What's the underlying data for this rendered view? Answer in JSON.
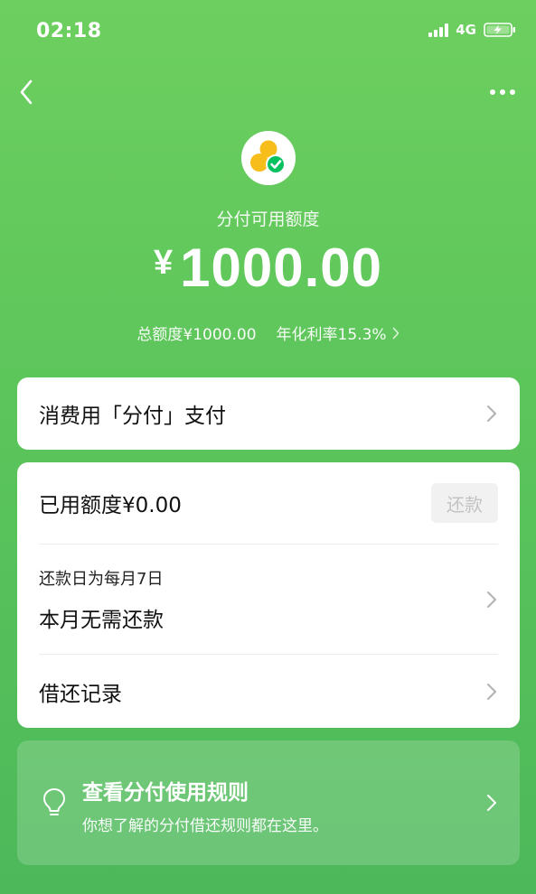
{
  "status_bar": {
    "time": "02:18",
    "network": "4G"
  },
  "header": {
    "credit_label": "分付可用额度",
    "currency_symbol": "¥",
    "available_amount": "1000.00",
    "total_credit": "总额度¥1000.00",
    "annual_rate": "年化利率15.3%"
  },
  "pay_card": {
    "title": "消费用「分付」支付"
  },
  "main_card": {
    "used_credit": "已用额度¥0.00",
    "repay_button": "还款",
    "repay_day": "还款日为每月7日",
    "repay_status": "本月无需还款",
    "records": "借还记录"
  },
  "rules_card": {
    "title": "查看分付使用规则",
    "subtitle": "你想了解的分付借还规则都在这里。"
  },
  "colors": {
    "brand_green": "#5cc55b",
    "check_green": "#07c160",
    "coin_yellow": "#f7bd1a"
  },
  "icons": {
    "back": "chevron-left-icon",
    "more": "more-dots-icon",
    "logo": "fenfu-coins-logo",
    "chevron": "chevron-right-icon",
    "bulb": "lightbulb-icon"
  }
}
